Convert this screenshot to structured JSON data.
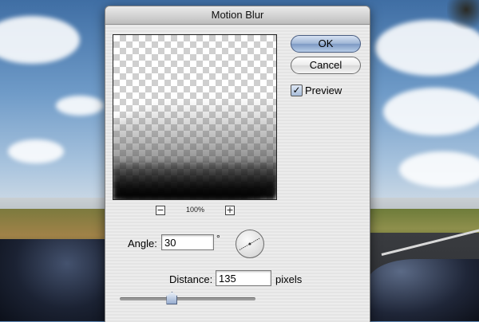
{
  "dialog": {
    "title": "Motion Blur"
  },
  "buttons": {
    "ok_label": "OK",
    "cancel_label": "Cancel"
  },
  "preview": {
    "checkbox_checked": true,
    "checkmark": "✓",
    "label": "Preview",
    "zoom_out_label": "−",
    "zoom_in_label": "+",
    "zoom_level": "100%"
  },
  "angle": {
    "label": "Angle:",
    "value": "30",
    "unit_symbol": "°"
  },
  "distance": {
    "label": "Distance:",
    "value": "135",
    "unit": "pixels",
    "slider_fraction": 0.37
  },
  "colors": {
    "ok_button_accent": "#8fa9d2",
    "dialog_background": "#e9e9e9"
  }
}
